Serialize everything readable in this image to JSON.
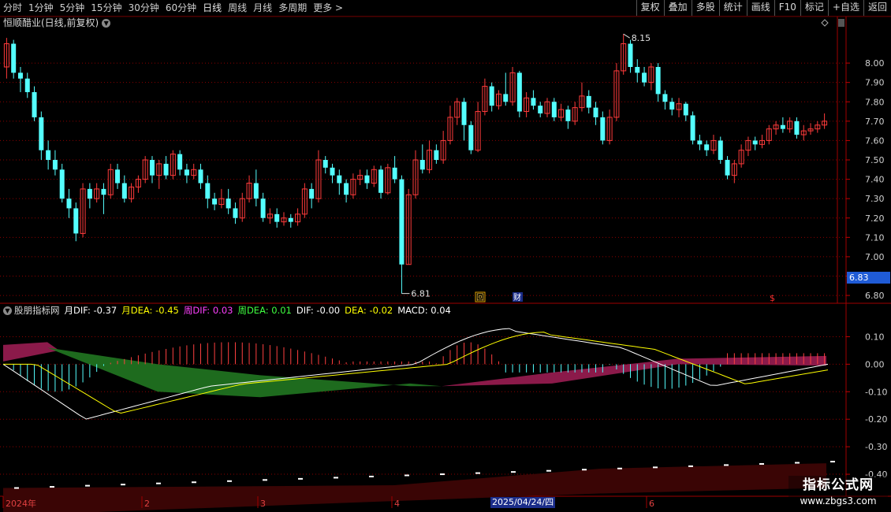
{
  "toolbar": {
    "periods": [
      "分时",
      "1分钟",
      "5分钟",
      "15分钟",
      "30分钟",
      "60分钟",
      "日线",
      "周线",
      "月线",
      "多周期",
      "更多 >"
    ],
    "actions": [
      "复权",
      "叠加",
      "多股",
      "统计",
      "画线",
      "F10",
      "标记",
      "+自选",
      "返回"
    ]
  },
  "stock_title": "恒顺醋业(日线,前复权)",
  "main_axis": {
    "ticks": [
      "8.00",
      "7.90",
      "7.80",
      "7.70",
      "7.60",
      "7.50",
      "7.40",
      "7.30",
      "7.20",
      "7.10",
      "7.00",
      "6.90",
      "6.80"
    ]
  },
  "price_marks": {
    "high": "8.15",
    "low": "6.81",
    "current": "6.83"
  },
  "event_marks": {
    "mark1": "回",
    "mark2": "财",
    "mark3": "$"
  },
  "indicator": {
    "name": "股朋指标网",
    "m_dif_label": "月DIF: -0.37",
    "m_dea_label": "月DEA: -0.45",
    "w_dif_label": "周DIF: 0.03",
    "w_dea_label": "周DEA: 0.01",
    "dif_label": "DIF: -0.00",
    "dea_label": "DEA: -0.02",
    "macd_label": "MACD: 0.04",
    "axis_ticks": [
      "0.10",
      "0.00",
      "-0.10",
      "-0.20",
      "-0.30",
      "-0.40"
    ]
  },
  "date_axis": {
    "labels": [
      "2024年",
      "2",
      "3",
      "4",
      "6"
    ],
    "highlight": "2025/04/24/四"
  },
  "watermark": {
    "line1": "指标公式网",
    "line2": "www.zbgs3.com"
  },
  "colors": {
    "up": "#ff3b3b",
    "down": "#54ffff",
    "grid": "#8b0000",
    "dif": "#ffffff",
    "dea": "#ffff00"
  },
  "chart_data": {
    "type": "candlestick",
    "ylim": [
      6.78,
      8.22
    ],
    "candles": [
      [
        7.98,
        8.1,
        8.13,
        7.92
      ],
      [
        8.1,
        7.95,
        8.12,
        7.92
      ],
      [
        7.95,
        7.92,
        7.98,
        7.85
      ],
      [
        7.92,
        7.85,
        7.95,
        7.82
      ],
      [
        7.85,
        7.72,
        7.88,
        7.7
      ],
      [
        7.72,
        7.55,
        7.75,
        7.5
      ],
      [
        7.55,
        7.5,
        7.6,
        7.45
      ],
      [
        7.5,
        7.45,
        7.55,
        7.42
      ],
      [
        7.45,
        7.3,
        7.48,
        7.28
      ],
      [
        7.3,
        7.25,
        7.35,
        7.2
      ],
      [
        7.25,
        7.12,
        7.28,
        7.08
      ],
      [
        7.12,
        7.35,
        7.38,
        7.1
      ],
      [
        7.35,
        7.3,
        7.38,
        7.25
      ],
      [
        7.3,
        7.35,
        7.38,
        7.28
      ],
      [
        7.35,
        7.32,
        7.38,
        7.22
      ],
      [
        7.32,
        7.45,
        7.48,
        7.3
      ],
      [
        7.45,
        7.38,
        7.48,
        7.35
      ],
      [
        7.38,
        7.3,
        7.42,
        7.28
      ],
      [
        7.3,
        7.36,
        7.38,
        7.28
      ],
      [
        7.36,
        7.4,
        7.42,
        7.33
      ],
      [
        7.4,
        7.5,
        7.52,
        7.38
      ],
      [
        7.5,
        7.42,
        7.52,
        7.38
      ],
      [
        7.42,
        7.48,
        7.5,
        7.35
      ],
      [
        7.48,
        7.42,
        7.52,
        7.4
      ],
      [
        7.42,
        7.53,
        7.55,
        7.4
      ],
      [
        7.53,
        7.45,
        7.55,
        7.42
      ],
      [
        7.45,
        7.42,
        7.48,
        7.38
      ],
      [
        7.42,
        7.45,
        7.48,
        7.4
      ],
      [
        7.45,
        7.38,
        7.48,
        7.35
      ],
      [
        7.38,
        7.3,
        7.42,
        7.25
      ],
      [
        7.3,
        7.27,
        7.33,
        7.24
      ],
      [
        7.27,
        7.3,
        7.35,
        7.25
      ],
      [
        7.3,
        7.25,
        7.35,
        7.22
      ],
      [
        7.25,
        7.2,
        7.28,
        7.17
      ],
      [
        7.2,
        7.3,
        7.33,
        7.18
      ],
      [
        7.3,
        7.38,
        7.42,
        7.28
      ],
      [
        7.38,
        7.3,
        7.45,
        7.26
      ],
      [
        7.3,
        7.2,
        7.33,
        7.18
      ],
      [
        7.2,
        7.22,
        7.25,
        7.17
      ],
      [
        7.22,
        7.18,
        7.25,
        7.15
      ],
      [
        7.18,
        7.2,
        7.23,
        7.16
      ],
      [
        7.2,
        7.18,
        7.22,
        7.15
      ],
      [
        7.18,
        7.22,
        7.25,
        7.16
      ],
      [
        7.22,
        7.35,
        7.38,
        7.2
      ],
      [
        7.35,
        7.3,
        7.38,
        7.25
      ],
      [
        7.3,
        7.5,
        7.55,
        7.28
      ],
      [
        7.5,
        7.46,
        7.52,
        7.43
      ],
      [
        7.46,
        7.42,
        7.48,
        7.38
      ],
      [
        7.42,
        7.38,
        7.45,
        7.32
      ],
      [
        7.38,
        7.32,
        7.4,
        7.28
      ],
      [
        7.32,
        7.4,
        7.43,
        7.3
      ],
      [
        7.4,
        7.42,
        7.45,
        7.37
      ],
      [
        7.42,
        7.38,
        7.45,
        7.35
      ],
      [
        7.38,
        7.45,
        7.47,
        7.36
      ],
      [
        7.45,
        7.33,
        7.47,
        7.3
      ],
      [
        7.33,
        7.46,
        7.48,
        7.32
      ],
      [
        7.46,
        7.4,
        7.52,
        7.38
      ],
      [
        7.4,
        6.96,
        7.42,
        6.81
      ],
      [
        6.96,
        7.32,
        7.35,
        6.96
      ],
      [
        7.32,
        7.5,
        7.55,
        7.3
      ],
      [
        7.5,
        7.45,
        7.58,
        7.43
      ],
      [
        7.45,
        7.55,
        7.6,
        7.43
      ],
      [
        7.55,
        7.5,
        7.58,
        7.48
      ],
      [
        7.5,
        7.6,
        7.65,
        7.48
      ],
      [
        7.6,
        7.72,
        7.78,
        7.58
      ],
      [
        7.72,
        7.8,
        7.82,
        7.68
      ],
      [
        7.8,
        7.68,
        7.82,
        7.6
      ],
      [
        7.68,
        7.55,
        7.7,
        7.53
      ],
      [
        7.55,
        7.75,
        7.8,
        7.54
      ],
      [
        7.75,
        7.88,
        7.92,
        7.73
      ],
      [
        7.88,
        7.78,
        7.9,
        7.75
      ],
      [
        7.78,
        7.84,
        7.86,
        7.76
      ],
      [
        7.84,
        7.8,
        7.95,
        7.78
      ],
      [
        7.8,
        7.95,
        7.98,
        7.78
      ],
      [
        7.95,
        7.75,
        7.96,
        7.72
      ],
      [
        7.75,
        7.82,
        7.85,
        7.72
      ],
      [
        7.82,
        7.78,
        7.86,
        7.76
      ],
      [
        7.78,
        7.74,
        7.8,
        7.72
      ],
      [
        7.74,
        7.8,
        7.82,
        7.72
      ],
      [
        7.8,
        7.72,
        7.82,
        7.7
      ],
      [
        7.72,
        7.76,
        7.79,
        7.7
      ],
      [
        7.76,
        7.7,
        7.78,
        7.66
      ],
      [
        7.7,
        7.77,
        7.8,
        7.68
      ],
      [
        7.77,
        7.83,
        7.9,
        7.75
      ],
      [
        7.83,
        7.77,
        7.86,
        7.74
      ],
      [
        7.77,
        7.72,
        7.8,
        7.68
      ],
      [
        7.72,
        7.6,
        7.75,
        7.58
      ],
      [
        7.6,
        7.72,
        7.76,
        7.58
      ],
      [
        7.72,
        7.96,
        8.0,
        7.7
      ],
      [
        7.96,
        8.1,
        8.15,
        7.94
      ],
      [
        8.1,
        7.98,
        8.12,
        7.95
      ],
      [
        7.98,
        7.95,
        8.02,
        7.9
      ],
      [
        7.95,
        7.9,
        7.98,
        7.88
      ],
      [
        7.9,
        7.98,
        8.0,
        7.86
      ],
      [
        7.98,
        7.84,
        8.0,
        7.8
      ],
      [
        7.84,
        7.8,
        7.86,
        7.76
      ],
      [
        7.8,
        7.76,
        7.82,
        7.73
      ],
      [
        7.76,
        7.79,
        7.82,
        7.72
      ],
      [
        7.79,
        7.73,
        7.8,
        7.7
      ],
      [
        7.73,
        7.6,
        7.75,
        7.58
      ],
      [
        7.6,
        7.58,
        7.63,
        7.55
      ],
      [
        7.58,
        7.55,
        7.6,
        7.52
      ],
      [
        7.55,
        7.6,
        7.63,
        7.53
      ],
      [
        7.6,
        7.5,
        7.62,
        7.48
      ],
      [
        7.5,
        7.42,
        7.52,
        7.4
      ],
      [
        7.42,
        7.48,
        7.5,
        7.38
      ],
      [
        7.48,
        7.55,
        7.58,
        7.46
      ],
      [
        7.55,
        7.6,
        7.62,
        7.52
      ],
      [
        7.6,
        7.58,
        7.62,
        7.55
      ],
      [
        7.58,
        7.6,
        7.63,
        7.56
      ],
      [
        7.6,
        7.66,
        7.68,
        7.58
      ],
      [
        7.66,
        7.68,
        7.7,
        7.63
      ],
      [
        7.68,
        7.66,
        7.72,
        7.64
      ],
      [
        7.66,
        7.7,
        7.72,
        7.64
      ],
      [
        7.7,
        7.63,
        7.72,
        7.61
      ],
      [
        7.63,
        7.65,
        7.68,
        7.6
      ],
      [
        7.65,
        7.66,
        7.69,
        7.63
      ],
      [
        7.66,
        7.68,
        7.7,
        7.64
      ],
      [
        7.68,
        7.7,
        7.74,
        7.66
      ]
    ]
  }
}
